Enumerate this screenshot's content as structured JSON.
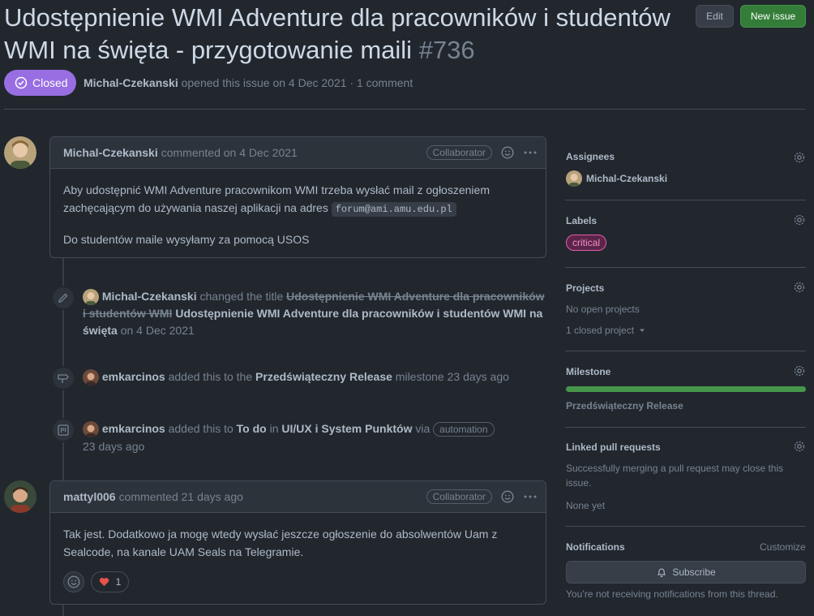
{
  "issue": {
    "title": "Udostępnienie WMI Adventure dla pracowników i studentów WMI na święta - przygotowanie maili",
    "number": "#736",
    "status": "Closed",
    "author": "Michal-Czekanski",
    "opened_text": "opened this issue on 4 Dec 2021 · 1 comment",
    "edit_label": "Edit",
    "new_issue_label": "New issue"
  },
  "comment1": {
    "author": "Michal-Czekanski",
    "meta": "commented on 4 Dec 2021",
    "badge": "Collaborator",
    "line1": "Aby udostępnić WMI Adventure pracownikom WMI trzeba wysłać mail z ogłoszeniem",
    "line2": "zachęcającym do używania naszej aplikacji na adres",
    "email": "forum@ami.amu.edu.pl",
    "para2": "Do studentów maile wysyłamy za pomocą USOS"
  },
  "event_title": {
    "author": "Michal-Czekanski",
    "action": "changed the title",
    "old_title": "Udostępnienie WMI Adventure dla pracowników i studentów WMI",
    "new_title": "Udostępnienie WMI Adventure dla pracowników i studentów WMI na święta",
    "date": "on 4 Dec 2021"
  },
  "event_milestone": {
    "author": "emkarcinos",
    "action": "added this to the",
    "milestone": "Przedświąteczny Release",
    "suffix": "milestone 23 days ago"
  },
  "event_project": {
    "author": "emkarcinos",
    "action": "added this to",
    "column": "To do",
    "in": "in",
    "project": "UI/UX i System Punktów",
    "via": "via",
    "badge": "automation",
    "time": "23 days ago"
  },
  "comment2": {
    "author": "mattyl006",
    "meta": "commented 21 days ago",
    "badge": "Collaborator",
    "line1": "Tak jest. Dodatkowo ja mogę wtedy wysłać jeszcze ogłoszenie do absolwentów Uam z",
    "line2": "Sealcode, na kanale UAM Seals na Telegramie.",
    "heart_count": "1"
  },
  "sidebar": {
    "assignees_title": "Assignees",
    "assignee": "Michal-Czekanski",
    "labels_title": "Labels",
    "label": "critical",
    "projects_title": "Projects",
    "projects_none": "No open projects",
    "projects_closed": "1 closed project",
    "milestone_title": "Milestone",
    "milestone_progress": 1.0,
    "milestone_name": "Przedświąteczny Release",
    "linked_title": "Linked pull requests",
    "linked_desc": "Successfully merging a pull request may close this issue.",
    "linked_none": "None yet",
    "notifications_title": "Notifications",
    "customize": "Customize",
    "subscribe": "Subscribe",
    "not_receiving": "You’re not receiving notifications from this thread."
  },
  "colors": {
    "closed": "#986ee2",
    "green": "#347d39",
    "label_critical": "#e85aad"
  }
}
